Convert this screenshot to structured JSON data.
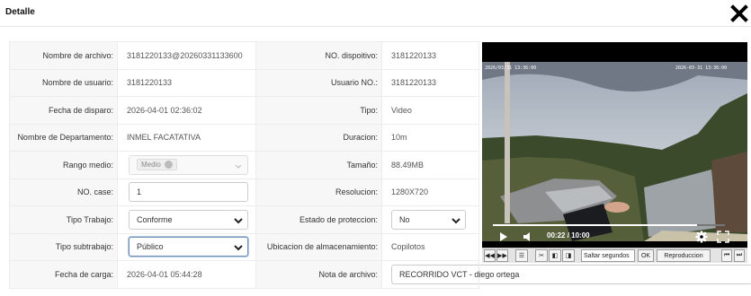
{
  "dialog": {
    "title": "Detalle",
    "close_icon": "close-icon"
  },
  "details": {
    "file_name_label": "Nombre de archivo:",
    "file_name_value": "3181220133@20260331133600",
    "device_label": "NO. dispoitivo:",
    "device_value": "3181220133",
    "user_name_label": "Nombre de usuario:",
    "user_name_value": "3181220133",
    "user_no_label": "Usuario NO.:",
    "user_no_value": "3181220133",
    "trigger_date_label": "Fecha de disparo:",
    "trigger_date_value": "2026-04-01 02:36:02",
    "type_label": "Tipo:",
    "type_value": "Video",
    "department_label": "Nombre de Departamento:",
    "department_value": "INMEL FACATATIVA",
    "duration_label": "Duracion:",
    "duration_value": "10m",
    "medium_range_label": "Rango medio:",
    "medium_range_tag": "Medio",
    "size_label": "Tamaño:",
    "size_value": "88.49MB",
    "case_no_label": "NO. case:",
    "case_no_value": "1",
    "resolution_label": "Resolucion:",
    "resolution_value": "1280X720",
    "work_type_label": "Tipo Trabajo:",
    "work_type_value": "Conforme",
    "protection_label": "Estado de proteccion:",
    "protection_value": "No",
    "work_subtype_label": "Tipo subtrabajo:",
    "work_subtype_value": "Público",
    "storage_label": "Ubicacion de almacenamiento:",
    "storage_value": "Copilotos",
    "upload_date_label": "Fecha de carga:",
    "upload_date_value": "2026-04-01 05:44:28",
    "file_note_label": "Nota de archivo:",
    "file_note_value": "RECORRIDO VCT - diego ortega"
  },
  "player": {
    "osd_left": "2026/03/31 13:36:00",
    "osd_right": "2026-03-31 13:36:00",
    "current_time": "00:22",
    "separator": " / ",
    "total_time": "10:00",
    "progress": 0.88,
    "toolbar": {
      "skip_placeholder": "Saltar segundos",
      "ok_label": "OK",
      "playback_label": "Reproduccion"
    }
  }
}
